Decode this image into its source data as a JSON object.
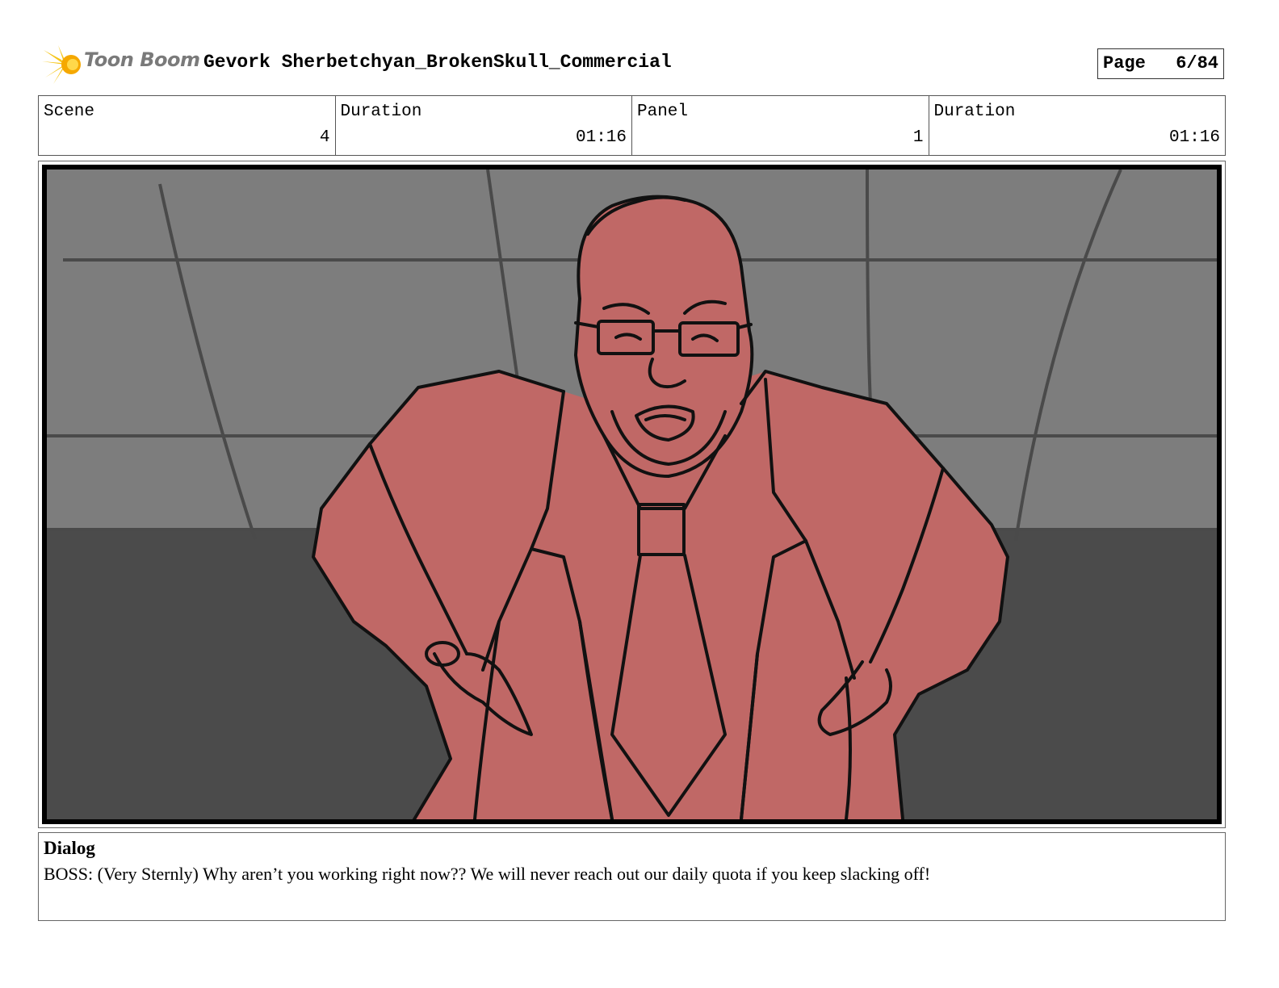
{
  "header": {
    "logo_text": "Toon Boom",
    "project_title": "Gevork Sherbetchyan_BrokenSkull_Commercial",
    "page_label": "Page",
    "page_value": "6/84"
  },
  "info": {
    "scene_label": "Scene",
    "scene_value": "4",
    "scene_duration_label": "Duration",
    "scene_duration_value": "01:16",
    "panel_label": "Panel",
    "panel_value": "1",
    "panel_duration_label": "Duration",
    "panel_duration_value": "01:16"
  },
  "panel": {
    "colors": {
      "wall": "#7d7d7d",
      "floor": "#4b4b4b",
      "character": "#c06866",
      "line": "#111111"
    }
  },
  "dialog": {
    "heading": "Dialog",
    "text": "BOSS: (Very Sternly) Why aren’t you working right now?? We will never reach out our daily quota if you keep slacking off!"
  }
}
